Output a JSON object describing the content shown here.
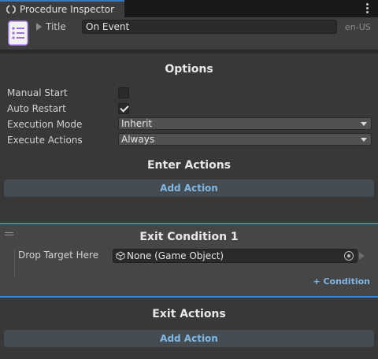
{
  "window": {
    "tab_title": "Procedure Inspector"
  },
  "header": {
    "title_label": "Title",
    "title_value": "On Event",
    "locale": "en-US"
  },
  "options": {
    "heading": "Options",
    "manual_start": {
      "label": "Manual Start",
      "checked": false
    },
    "auto_restart": {
      "label": "Auto Restart",
      "checked": true
    },
    "execution_mode": {
      "label": "Execution Mode",
      "value": "Inherit"
    },
    "execute_actions": {
      "label": "Execute Actions",
      "value": "Always"
    }
  },
  "enter_actions": {
    "heading": "Enter Actions",
    "add_label": "Add Action"
  },
  "exit_condition": {
    "heading": "Exit Condition 1",
    "field_label": "Drop Target Here",
    "field_value": "None (Game Object)",
    "add_condition_label": "+ Condition"
  },
  "exit_actions": {
    "heading": "Exit Actions",
    "add_label": "Add Action"
  },
  "colors": {
    "accent": "#3a87cf",
    "link": "#7fb8e6",
    "background": "#383838"
  }
}
